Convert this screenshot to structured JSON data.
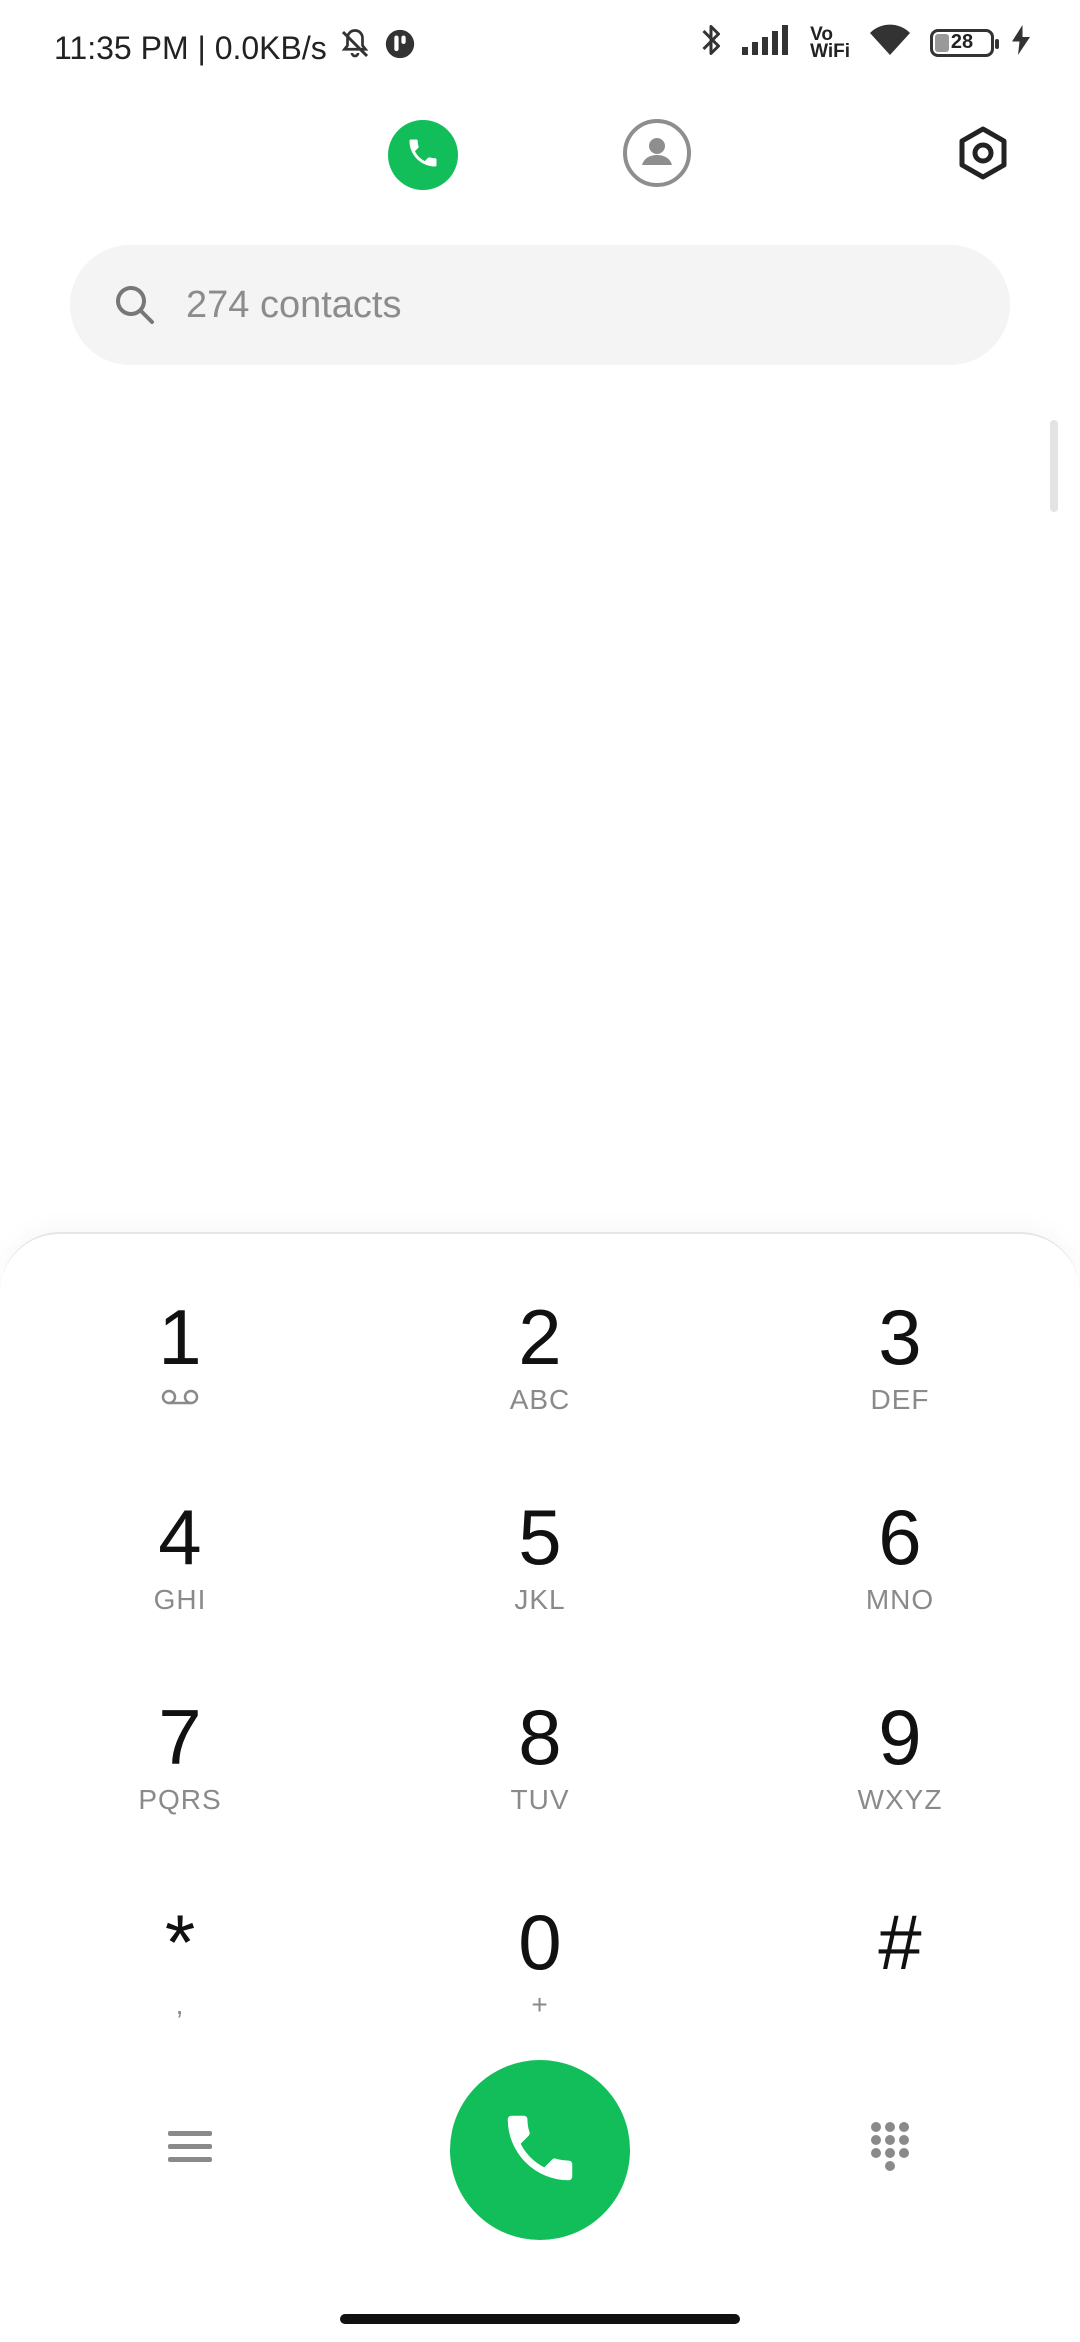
{
  "status_bar": {
    "time_speed": "11:35 PM | 0.0KB/s",
    "vowifi_top": "Vo",
    "vowifi_bottom": "WiFi",
    "battery": "28"
  },
  "search": {
    "placeholder": "274 contacts"
  },
  "keypad": [
    {
      "digit": "1",
      "letters": ""
    },
    {
      "digit": "2",
      "letters": "ABC"
    },
    {
      "digit": "3",
      "letters": "DEF"
    },
    {
      "digit": "4",
      "letters": "GHI"
    },
    {
      "digit": "5",
      "letters": "JKL"
    },
    {
      "digit": "6",
      "letters": "MNO"
    },
    {
      "digit": "7",
      "letters": "PQRS"
    },
    {
      "digit": "8",
      "letters": "TUV"
    },
    {
      "digit": "9",
      "letters": "WXYZ"
    },
    {
      "digit": "*",
      "letters": ","
    },
    {
      "digit": "0",
      "letters": "+"
    },
    {
      "digit": "#",
      "letters": ""
    }
  ],
  "icons": {
    "tab_phone": "phone-icon",
    "tab_contacts": "person-icon",
    "settings": "settings-hexagon-icon",
    "search": "search-icon",
    "voicemail": "voicemail-icon",
    "menu": "menu-icon",
    "call": "phone-icon",
    "keypad_toggle": "dialpad-icon"
  },
  "colors": {
    "accent_green": "#11be5a"
  }
}
